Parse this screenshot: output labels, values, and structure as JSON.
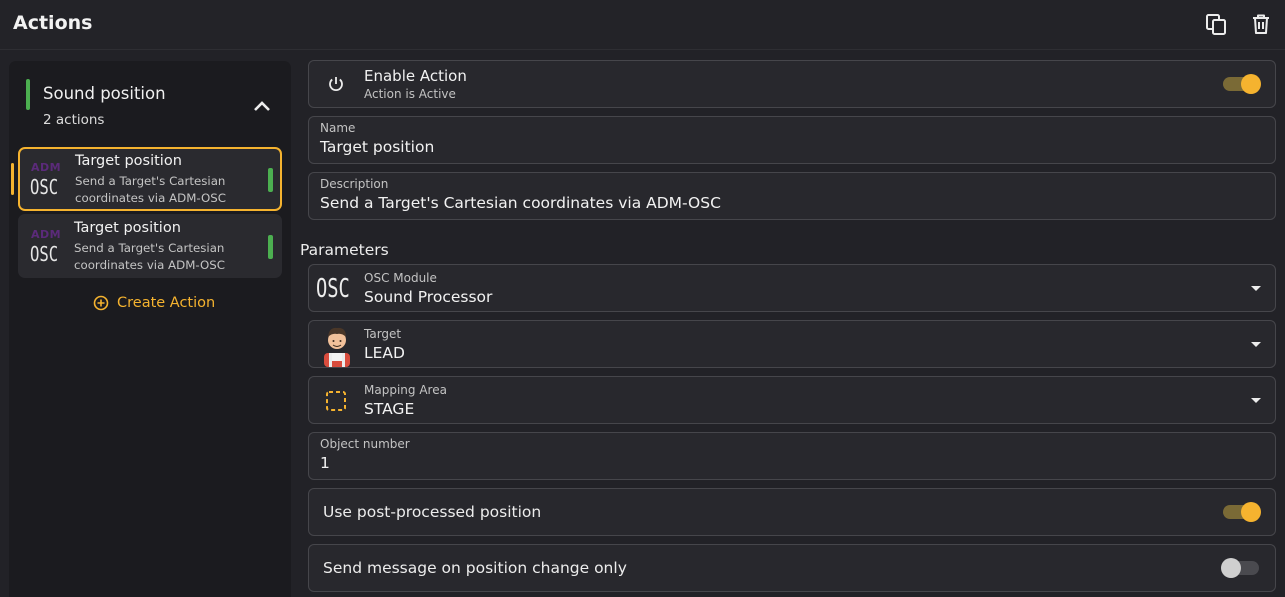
{
  "header": {
    "title": "Actions",
    "duplicate_icon": "duplicate-icon",
    "delete_icon": "trash-icon"
  },
  "sidebar": {
    "group": {
      "name": "Sound position",
      "count": "2 actions",
      "accent_color": "#4caf50"
    },
    "items": [
      {
        "logo_top": "ADM",
        "logo_bottom": "OSC",
        "title": "Target position",
        "description": "Send a Target's Cartesian coordinates via ADM-OSC",
        "selected": true
      },
      {
        "logo_top": "ADM",
        "logo_bottom": "OSC",
        "title": "Target position",
        "description": "Send a Target's Cartesian coordinates via ADM-OSC",
        "selected": false
      }
    ],
    "create_label": "Create Action"
  },
  "main": {
    "enable": {
      "title": "Enable Action",
      "subtitle": "Action is Active",
      "enabled": true
    },
    "name": {
      "label": "Name",
      "value": "Target position"
    },
    "description": {
      "label": "Description",
      "value": "Send a Target's Cartesian coordinates via ADM-OSC"
    },
    "parameters_title": "Parameters",
    "osc_module": {
      "icon_text": "OSC",
      "label": "OSC Module",
      "value": "Sound Processor"
    },
    "target": {
      "label": "Target",
      "value": "LEAD"
    },
    "mapping_area": {
      "label": "Mapping Area",
      "value": "STAGE"
    },
    "object_number": {
      "label": "Object number",
      "value": "1"
    },
    "post_processed": {
      "label": "Use post-processed position",
      "enabled": true
    },
    "change_only": {
      "label": "Send message on position change only",
      "enabled": false
    }
  },
  "colors": {
    "accent": "#f5b32f",
    "success": "#4caf50",
    "background": "#222227"
  }
}
